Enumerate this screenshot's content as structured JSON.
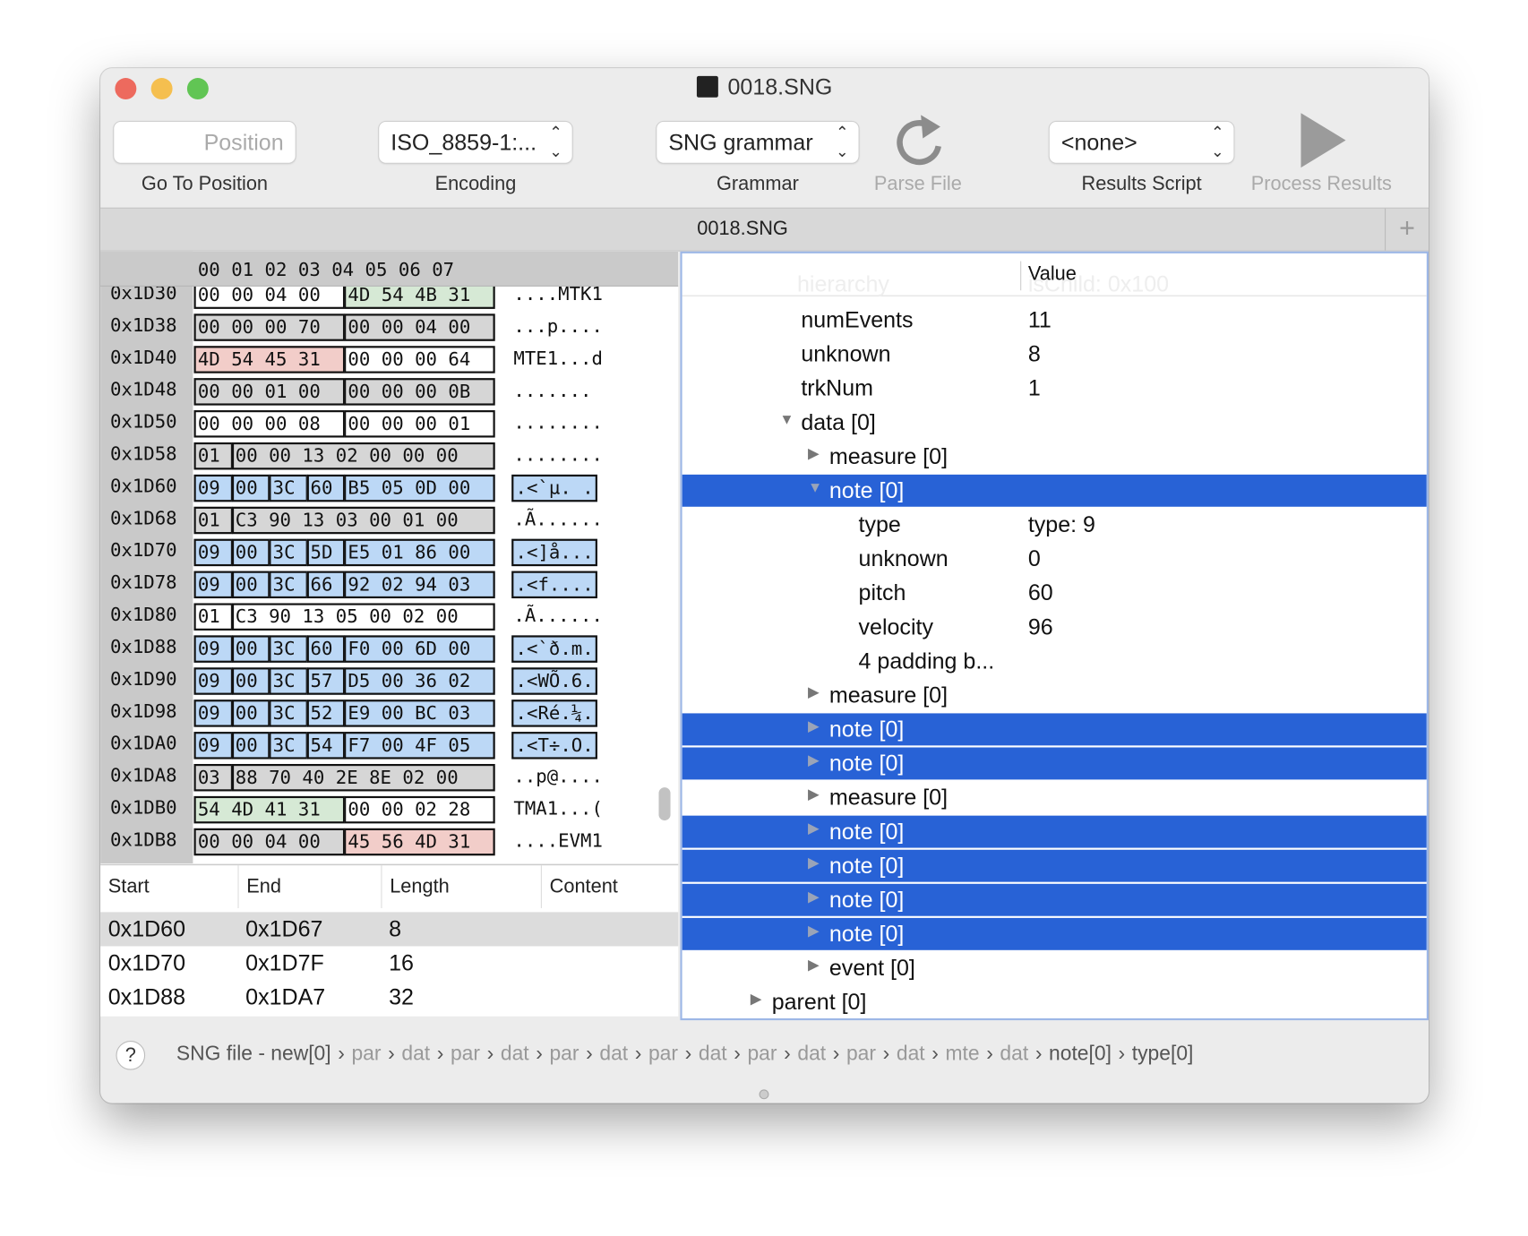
{
  "window": {
    "title": "0018.SNG",
    "traffic_lights": {
      "close": "#ed6a5e",
      "minimize": "#f5bf4f",
      "zoom": "#61c554"
    }
  },
  "toolbar": {
    "position": {
      "placeholder": "Position",
      "label": "Go To Position"
    },
    "encoding": {
      "value": "ISO_8859-1:...",
      "label": "Encoding"
    },
    "grammar": {
      "value": "SNG grammar",
      "label": "Grammar"
    },
    "parse": {
      "label": "Parse File",
      "icon": "reload-icon"
    },
    "results_script": {
      "value": "<none>",
      "label": "Results Script"
    },
    "process": {
      "label": "Process Results",
      "icon": "play-icon"
    }
  },
  "tab": {
    "label": "0018.SNG",
    "add_label": "+"
  },
  "hex": {
    "columns": "00 01 02 03 04 05 06 07",
    "colors": {
      "white": "#ffffff",
      "gray": "#d6d6d6",
      "green": "#d6e9d5",
      "red": "#f2cdc9",
      "blue": "#bcd8f6"
    },
    "rows": [
      {
        "addr": "0x1D30",
        "groups": [
          {
            "b": "00 00 04 00",
            "c": "white"
          },
          {
            "b": "4D 54 4B 31",
            "c": "green"
          }
        ],
        "ascii": "....MTK1"
      },
      {
        "addr": "0x1D38",
        "groups": [
          {
            "b": "00 00 00 70",
            "c": "gray"
          },
          {
            "b": "00 00 04 00",
            "c": "gray"
          }
        ],
        "ascii": "...p...."
      },
      {
        "addr": "0x1D40",
        "groups": [
          {
            "b": "4D 54 45 31",
            "c": "red"
          },
          {
            "b": "00 00 00 64",
            "c": "white"
          }
        ],
        "ascii": "MTE1...d"
      },
      {
        "addr": "0x1D48",
        "groups": [
          {
            "b": "00 00 01 00",
            "c": "gray"
          },
          {
            "b": "00 00 00 0B",
            "c": "gray"
          }
        ],
        "ascii": "......."
      },
      {
        "addr": "0x1D50",
        "groups": [
          {
            "b": "00 00 00 08",
            "c": "white"
          },
          {
            "b": "00 00 00 01",
            "c": "white"
          }
        ],
        "ascii": "........"
      },
      {
        "addr": "0x1D58",
        "groups": [
          {
            "b": "01",
            "c": "gray"
          },
          {
            "b": "00 00 13 02 00 00 00",
            "c": "gray"
          }
        ],
        "ascii": "........"
      },
      {
        "addr": "0x1D60",
        "groups": [
          {
            "b": "09",
            "c": "blue"
          },
          {
            "b": "00",
            "c": "blue"
          },
          {
            "b": "3C",
            "c": "blue"
          },
          {
            "b": "60",
            "c": "blue"
          },
          {
            "b": "B5 05 0D 00",
            "c": "blue"
          }
        ],
        "ascii": ".<`µ. .",
        "ascii_sel": true
      },
      {
        "addr": "0x1D68",
        "groups": [
          {
            "b": "01",
            "c": "gray"
          },
          {
            "b": "C3 90 13 03 00 01 00",
            "c": "gray"
          }
        ],
        "ascii": ".Ã......"
      },
      {
        "addr": "0x1D70",
        "groups": [
          {
            "b": "09",
            "c": "blue"
          },
          {
            "b": "00",
            "c": "blue"
          },
          {
            "b": "3C",
            "c": "blue"
          },
          {
            "b": "5D",
            "c": "blue"
          },
          {
            "b": "E5 01 86 00",
            "c": "blue"
          }
        ],
        "ascii": ".<]å...",
        "ascii_sel": true
      },
      {
        "addr": "0x1D78",
        "groups": [
          {
            "b": "09",
            "c": "blue"
          },
          {
            "b": "00",
            "c": "blue"
          },
          {
            "b": "3C",
            "c": "blue"
          },
          {
            "b": "66",
            "c": "blue"
          },
          {
            "b": "92 02 94 03",
            "c": "blue"
          }
        ],
        "ascii": ".<f....",
        "ascii_sel": true
      },
      {
        "addr": "0x1D80",
        "groups": [
          {
            "b": "01",
            "c": "white"
          },
          {
            "b": "C3 90 13 05 00 02 00",
            "c": "white"
          }
        ],
        "ascii": ".Ã......"
      },
      {
        "addr": "0x1D88",
        "groups": [
          {
            "b": "09",
            "c": "blue"
          },
          {
            "b": "00",
            "c": "blue"
          },
          {
            "b": "3C",
            "c": "blue"
          },
          {
            "b": "60",
            "c": "blue"
          },
          {
            "b": "F0 00 6D 00",
            "c": "blue"
          }
        ],
        "ascii": ".<`ð.m.",
        "ascii_sel": true
      },
      {
        "addr": "0x1D90",
        "groups": [
          {
            "b": "09",
            "c": "blue"
          },
          {
            "b": "00",
            "c": "blue"
          },
          {
            "b": "3C",
            "c": "blue"
          },
          {
            "b": "57",
            "c": "blue"
          },
          {
            "b": "D5 00 36 02",
            "c": "blue"
          }
        ],
        "ascii": ".<WÕ.6.",
        "ascii_sel": true
      },
      {
        "addr": "0x1D98",
        "groups": [
          {
            "b": "09",
            "c": "blue"
          },
          {
            "b": "00",
            "c": "blue"
          },
          {
            "b": "3C",
            "c": "blue"
          },
          {
            "b": "52",
            "c": "blue"
          },
          {
            "b": "E9 00 BC 03",
            "c": "blue"
          }
        ],
        "ascii": ".<Ré.¼.",
        "ascii_sel": true
      },
      {
        "addr": "0x1DA0",
        "groups": [
          {
            "b": "09",
            "c": "blue"
          },
          {
            "b": "00",
            "c": "blue"
          },
          {
            "b": "3C",
            "c": "blue"
          },
          {
            "b": "54",
            "c": "blue"
          },
          {
            "b": "F7 00 4F 05",
            "c": "blue"
          }
        ],
        "ascii": ".<T÷.O.",
        "ascii_sel": true
      },
      {
        "addr": "0x1DA8",
        "groups": [
          {
            "b": "03",
            "c": "gray"
          },
          {
            "b": "88 70 40 2E 8E 02 00",
            "c": "gray"
          }
        ],
        "ascii": "..p@...."
      },
      {
        "addr": "0x1DB0",
        "groups": [
          {
            "b": "54 4D 41 31",
            "c": "green"
          },
          {
            "b": "00 00 02 28",
            "c": "white"
          }
        ],
        "ascii": "TMA1...("
      },
      {
        "addr": "0x1DB8",
        "groups": [
          {
            "b": "00 00 04 00",
            "c": "gray"
          },
          {
            "b": "45 56 4D 31",
            "c": "red"
          }
        ],
        "ascii": "....EVM1"
      }
    ]
  },
  "ranges": {
    "headers": [
      "Start",
      "End",
      "Length",
      "Content"
    ],
    "rows": [
      {
        "start": "0x1D60",
        "end": "0x1D67",
        "length": "8",
        "content": ""
      },
      {
        "start": "0x1D70",
        "end": "0x1D7F",
        "length": "16",
        "content": ""
      },
      {
        "start": "0x1D88",
        "end": "0x1DA7",
        "length": "32",
        "content": ""
      }
    ]
  },
  "tree": {
    "value_header": "Value",
    "ghost": {
      "name": "hierarchy",
      "value": "isChild: 0x100"
    },
    "selection_color": "#2862d6",
    "nodes": [
      {
        "name": "numEvents",
        "value": "11",
        "level": 2,
        "toggle": "none"
      },
      {
        "name": "unknown",
        "value": "8",
        "level": 2,
        "toggle": "none"
      },
      {
        "name": "trkNum",
        "value": "1",
        "level": 2,
        "toggle": "none"
      },
      {
        "name": "data [0]",
        "value": "",
        "level": 2,
        "toggle": "open"
      },
      {
        "name": "measure [0]",
        "value": "",
        "level": 3,
        "toggle": "closed"
      },
      {
        "name": "note [0]",
        "value": "",
        "level": 3,
        "toggle": "open",
        "selected": true
      },
      {
        "name": "type",
        "value": "type: 9",
        "level": 4,
        "toggle": "none"
      },
      {
        "name": "unknown",
        "value": "0",
        "level": 4,
        "toggle": "none"
      },
      {
        "name": "pitch",
        "value": "60",
        "level": 4,
        "toggle": "none"
      },
      {
        "name": "velocity",
        "value": "96",
        "level": 4,
        "toggle": "none"
      },
      {
        "name": "4 padding b...",
        "value": "",
        "level": 4,
        "toggle": "none"
      },
      {
        "name": "measure [0]",
        "value": "",
        "level": 3,
        "toggle": "closed"
      },
      {
        "name": "note [0]",
        "value": "",
        "level": 3,
        "toggle": "closed",
        "selected": true
      },
      {
        "name": "note [0]",
        "value": "",
        "level": 3,
        "toggle": "closed",
        "selected": true
      },
      {
        "name": "measure [0]",
        "value": "",
        "level": 3,
        "toggle": "closed"
      },
      {
        "name": "note [0]",
        "value": "",
        "level": 3,
        "toggle": "closed",
        "selected": true
      },
      {
        "name": "note [0]",
        "value": "",
        "level": 3,
        "toggle": "closed",
        "selected": true
      },
      {
        "name": "note [0]",
        "value": "",
        "level": 3,
        "toggle": "closed",
        "selected": true
      },
      {
        "name": "note [0]",
        "value": "",
        "level": 3,
        "toggle": "closed",
        "selected": true
      },
      {
        "name": "event [0]",
        "value": "",
        "level": 3,
        "toggle": "closed"
      },
      {
        "name": "parent [0]",
        "value": "",
        "level": 1,
        "toggle": "closed"
      }
    ]
  },
  "breadcrumb": {
    "help_label": "?",
    "items": [
      {
        "label": "SNG file - new[0]",
        "faded": false
      },
      {
        "label": "par",
        "faded": true
      },
      {
        "label": "dat",
        "faded": true
      },
      {
        "label": "par",
        "faded": true
      },
      {
        "label": "dat",
        "faded": true
      },
      {
        "label": "par",
        "faded": true
      },
      {
        "label": "dat",
        "faded": true
      },
      {
        "label": "par",
        "faded": true
      },
      {
        "label": "dat",
        "faded": true
      },
      {
        "label": "par",
        "faded": true
      },
      {
        "label": "dat",
        "faded": true
      },
      {
        "label": "par",
        "faded": true
      },
      {
        "label": "dat",
        "faded": true
      },
      {
        "label": "mte",
        "faded": true
      },
      {
        "label": "dat",
        "faded": true
      },
      {
        "label": "note[0]",
        "faded": false
      },
      {
        "label": "type[0]",
        "faded": false
      }
    ]
  }
}
